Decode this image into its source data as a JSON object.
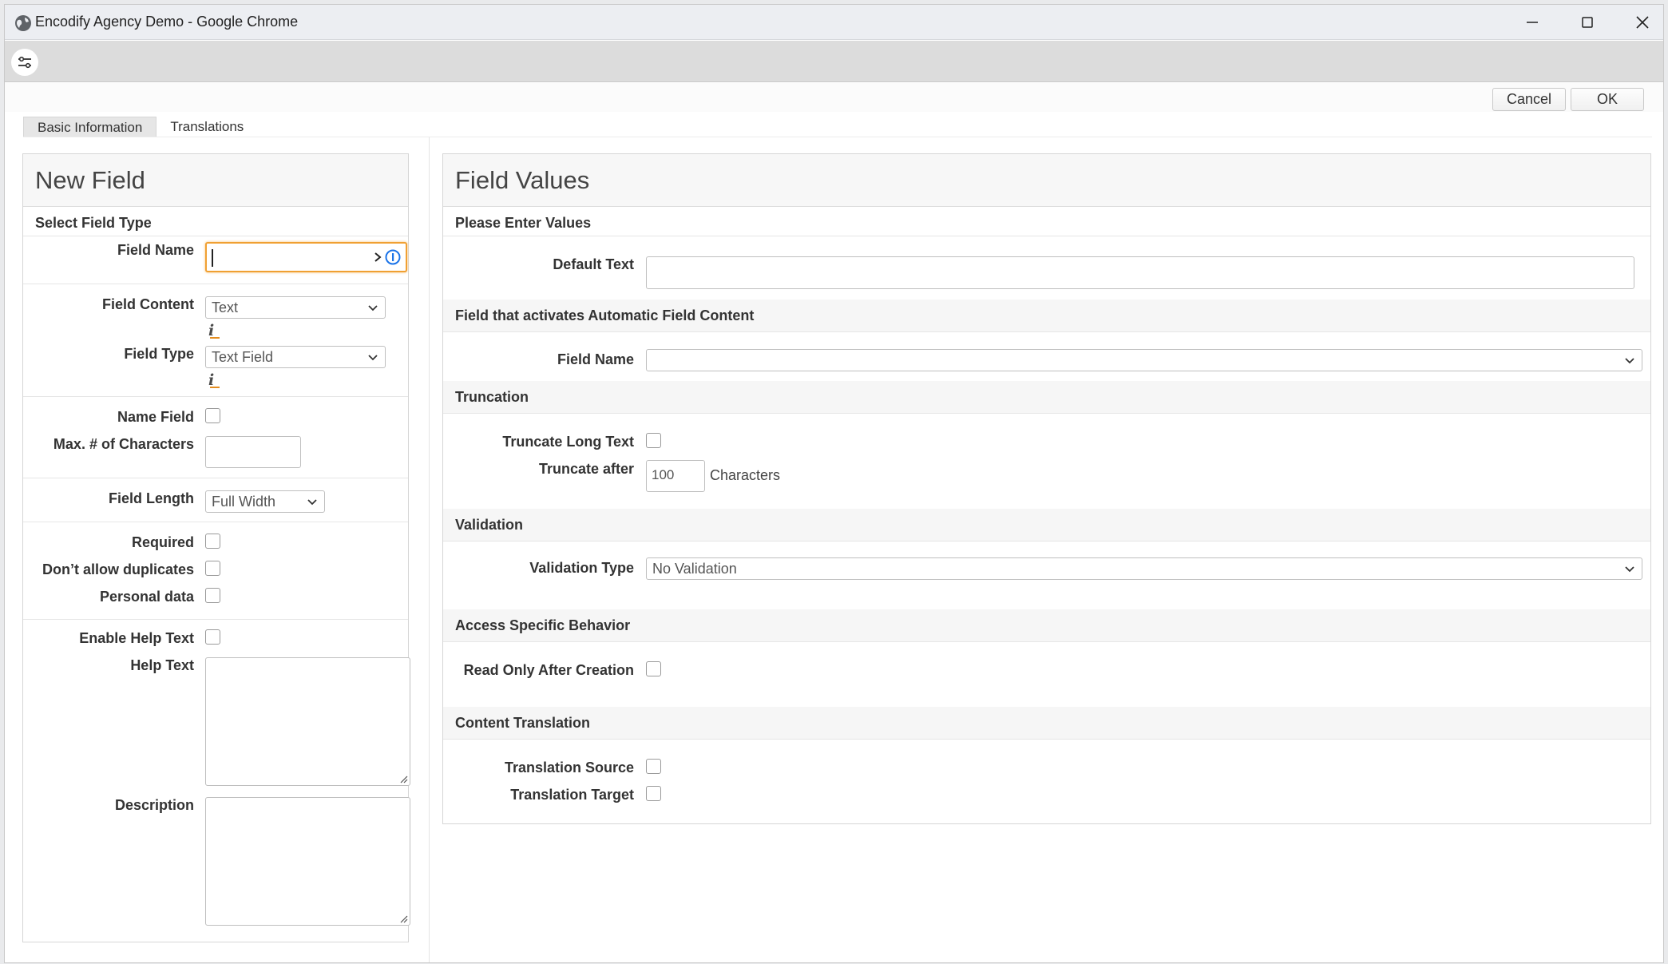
{
  "window": {
    "title": "Encodify Agency Demo - Google Chrome"
  },
  "actions": {
    "cancel": "Cancel",
    "ok": "OK"
  },
  "tabs": [
    {
      "label": "Basic Information",
      "active": true
    },
    {
      "label": "Translations",
      "active": false
    }
  ],
  "left": {
    "title": "New Field",
    "section": "Select Field Type",
    "field_name_label": "Field Name",
    "field_name_value": "",
    "field_content_label": "Field Content",
    "field_content_value": "Text",
    "field_type_label": "Field Type",
    "field_type_value": "Text Field",
    "name_field_label": "Name Field",
    "max_chars_label": "Max. # of Characters",
    "max_chars_value": "",
    "field_length_label": "Field Length",
    "field_length_value": "Full Width",
    "required_label": "Required",
    "no_duplicates_label": "Don’t allow duplicates",
    "personal_data_label": "Personal data",
    "enable_help_label": "Enable Help Text",
    "help_text_label": "Help Text",
    "description_label": "Description"
  },
  "right": {
    "title": "Field Values",
    "sec_values": "Please Enter Values",
    "default_text_label": "Default Text",
    "default_text_value": "",
    "sec_activates": "Field that activates Automatic Field Content",
    "field_name_label": "Field Name",
    "field_name_value": "",
    "sec_truncation": "Truncation",
    "truncate_long_label": "Truncate Long Text",
    "truncate_after_label": "Truncate after",
    "truncate_after_value": "100",
    "characters_label": "Characters",
    "sec_validation": "Validation",
    "validation_type_label": "Validation Type",
    "validation_type_value": "No Validation",
    "sec_access": "Access Specific Behavior",
    "read_only_label": "Read Only After Creation",
    "sec_translation": "Content Translation",
    "translation_source_label": "Translation Source",
    "translation_target_label": "Translation Target"
  },
  "colors": {
    "accent_focus": "#f0a032",
    "info_underline": "#e38c1f",
    "password_icon": "#1a73e8"
  },
  "icons": {
    "globe": "globe-icon",
    "minimize": "minimize-icon",
    "maximize": "maximize-icon",
    "close": "close-icon",
    "tune": "tune-icon",
    "info": "info-icon",
    "chevron": "chevron-down-icon"
  }
}
